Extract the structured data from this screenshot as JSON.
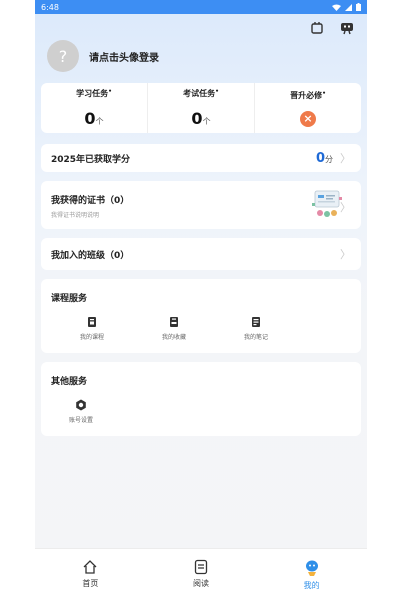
{
  "status_bar": {
    "time": "6:48"
  },
  "profile": {
    "avatar_glyph": "?",
    "login_prompt": "请点击头像登录"
  },
  "stats": [
    {
      "label": "学习任务",
      "value": "0",
      "unit": "个"
    },
    {
      "label": "考试任务",
      "value": "0",
      "unit": "个"
    },
    {
      "label": "晋升必修",
      "badge": "×"
    }
  ],
  "credits": {
    "label": "2025年已获取学分",
    "value": "0",
    "unit": "分"
  },
  "certificates": {
    "title": "我获得的证书（0）",
    "subtitle": "我得证书说明说明"
  },
  "classes": {
    "title": "我加入的班级（0）"
  },
  "course_services": {
    "title": "课程服务",
    "items": [
      {
        "label": "我的课程",
        "icon": "course-icon"
      },
      {
        "label": "我的收藏",
        "icon": "favorite-icon"
      },
      {
        "label": "我的笔记",
        "icon": "notes-icon"
      }
    ]
  },
  "other_services": {
    "title": "其他服务",
    "items": [
      {
        "label": "账号设置",
        "icon": "settings-icon"
      }
    ]
  },
  "tabbar": {
    "items": [
      {
        "label": "首页",
        "icon": "home-icon"
      },
      {
        "label": "阅读",
        "icon": "read-icon"
      },
      {
        "label": "我的",
        "icon": "mine-icon"
      }
    ],
    "active": "我的"
  },
  "colors": {
    "accent": "#2f8fe8",
    "status_bar": "#3d8ef3",
    "badge": "#ef7a4a",
    "credits": "#1f6ad6"
  }
}
